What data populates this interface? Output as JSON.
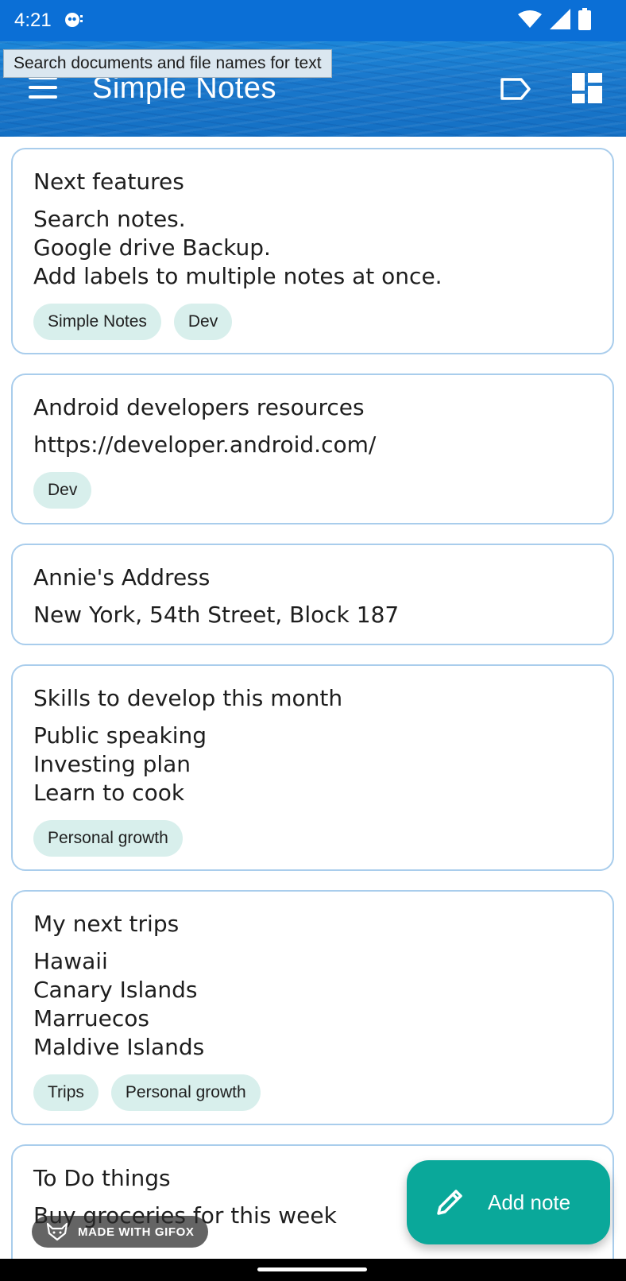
{
  "status_bar": {
    "time": "4:21",
    "icons": [
      "notification-icon",
      "wifi-icon",
      "signal-icon",
      "battery-icon"
    ]
  },
  "app_bar": {
    "title": "Simple Notes",
    "tooltip": "Search documents and file names for text",
    "icons": [
      "menu-icon",
      "label-icon",
      "layout-icon"
    ]
  },
  "notes": [
    {
      "title": "Next features",
      "lines": [
        "Search notes.",
        "Google drive Backup.",
        "Add labels to multiple notes at once."
      ],
      "labels": [
        "Simple Notes",
        "Dev"
      ]
    },
    {
      "title": "Android developers resources",
      "lines": [
        "https://developer.android.com/"
      ],
      "labels": [
        "Dev"
      ]
    },
    {
      "title": "Annie's Address",
      "lines": [
        "New York, 54th Street, Block 187"
      ],
      "labels": []
    },
    {
      "title": "Skills to develop this month",
      "lines": [
        "Public speaking",
        "Investing plan",
        "Learn to cook"
      ],
      "labels": [
        "Personal growth"
      ]
    },
    {
      "title": "My next trips",
      "lines": [
        "Hawaii",
        "Canary Islands",
        "Marruecos",
        "Maldive Islands"
      ],
      "labels": [
        "Trips",
        "Personal growth"
      ]
    },
    {
      "title": "To Do things",
      "lines": [
        "Buy groceries for this week"
      ],
      "labels": []
    }
  ],
  "fab": {
    "label": "Add note",
    "icon": "pencil-icon"
  },
  "watermark": {
    "text": "MADE WITH GIFOX",
    "icon": "fox-icon"
  },
  "colors": {
    "status_bar": "#0b6fd6",
    "note_border": "#a9cdec",
    "chip_bg": "#d8efec",
    "fab_bg": "#0aa89a"
  }
}
